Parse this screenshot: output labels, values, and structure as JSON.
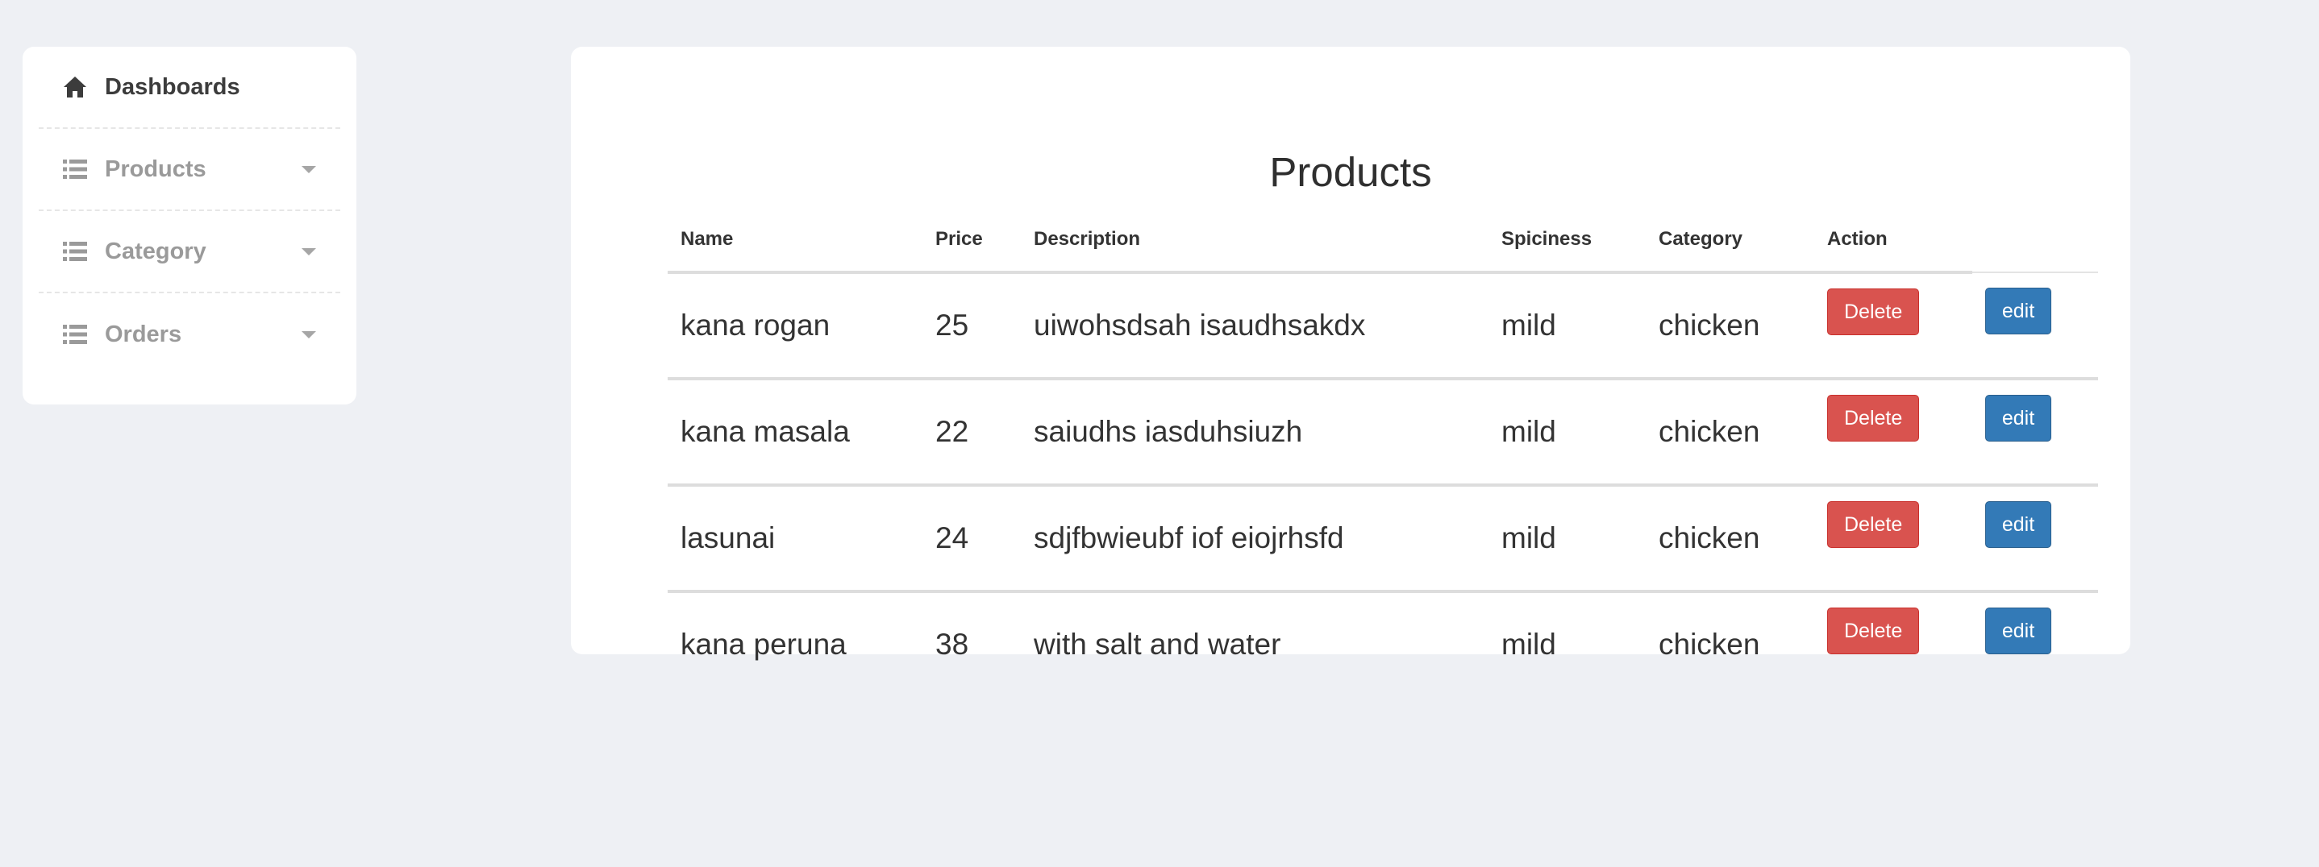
{
  "sidebar": {
    "items": [
      {
        "label": "Dashboards",
        "icon": "home-icon",
        "active": true
      },
      {
        "label": "Products",
        "icon": "list-icon",
        "has_dropdown": true
      },
      {
        "label": "Category",
        "icon": "list-icon",
        "has_dropdown": true
      },
      {
        "label": "Orders",
        "icon": "list-icon",
        "has_dropdown": true
      }
    ]
  },
  "main": {
    "title": "Products",
    "table": {
      "headers": [
        "Name",
        "Price",
        "Description",
        "Spiciness",
        "Category",
        "Action",
        ""
      ],
      "rows": [
        {
          "name": "kana rogan",
          "price": "25",
          "description": "uiwohsdsah isaudhsakdx",
          "spiciness": "mild",
          "category": "chicken",
          "delete_label": "Delete",
          "edit_label": "edit"
        },
        {
          "name": "kana masala",
          "price": "22",
          "description": "saiudhs iasduhsiuzh",
          "spiciness": "mild",
          "category": "chicken",
          "delete_label": "Delete",
          "edit_label": "edit"
        },
        {
          "name": "lasunai",
          "price": "24",
          "description": "sdjfbwieubf iof eiojrhsfd",
          "spiciness": "mild",
          "category": "chicken",
          "delete_label": "Delete",
          "edit_label": "edit"
        },
        {
          "name": "kana peruna",
          "price": "38",
          "description": "with salt and water",
          "spiciness": "mild",
          "category": "chicken",
          "delete_label": "Delete",
          "edit_label": "edit"
        }
      ]
    }
  },
  "colors": {
    "background": "#eef0f4",
    "delete_button": "#d9534f",
    "edit_button": "#337ab7"
  }
}
